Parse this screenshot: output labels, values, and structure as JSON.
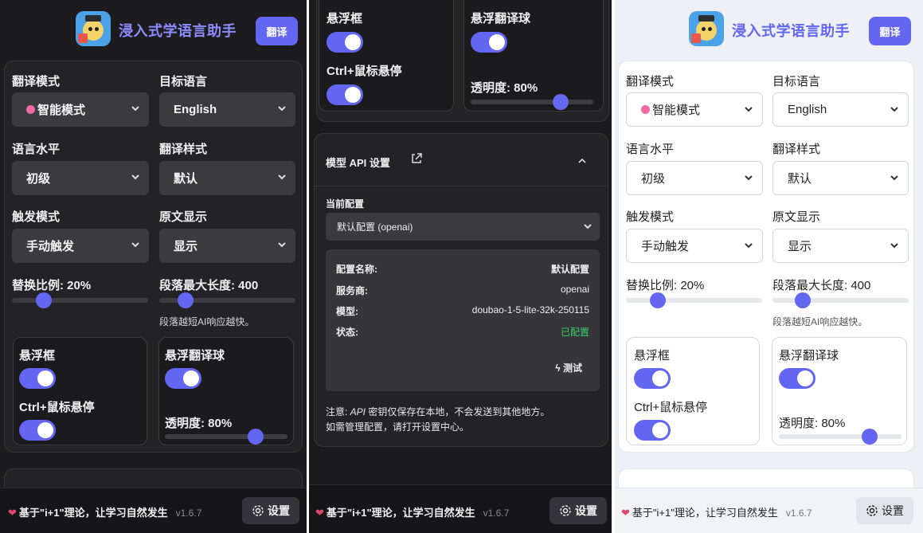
{
  "header": {
    "title": "浸入式学语言助手",
    "translate_button": "翻译"
  },
  "settings": {
    "translation_mode": {
      "label": "翻译模式",
      "value": "智能模式"
    },
    "target_language": {
      "label": "目标语言",
      "value": "English"
    },
    "language_level": {
      "label": "语言水平",
      "value": "初级"
    },
    "translation_style": {
      "label": "翻译样式",
      "value": "默认"
    },
    "trigger_mode": {
      "label": "触发模式",
      "value": "手动触发"
    },
    "original_display": {
      "label": "原文显示",
      "value": "显示"
    },
    "replace_ratio": {
      "label": "替换比例: 20%",
      "value": 0.2
    },
    "max_paragraph": {
      "label": "段落最大长度: 400",
      "value": 0.2,
      "hint": "段落越短AI响应越快。"
    }
  },
  "toggles": {
    "float_box": {
      "label": "悬浮框",
      "on": true
    },
    "ctrl_hover": {
      "label": "Ctrl+鼠标悬停",
      "on": true
    },
    "float_ball": {
      "label": "悬浮翻译球",
      "on": true
    },
    "opacity": {
      "label": "透明度: 80%",
      "value": 0.8
    }
  },
  "api": {
    "title": "模型 API 设置",
    "current_label": "当前配置",
    "current_value": "默认配置 (openai)",
    "rows": [
      {
        "k": "配置名称:",
        "v": "默认配置"
      },
      {
        "k": "服务商:",
        "v": "openai"
      },
      {
        "k": "模型:",
        "v": "doubao-1-5-lite-32k-250115"
      },
      {
        "k": "状态:",
        "v": "已配置"
      }
    ],
    "test_button": "测试",
    "note_line1_prefix": "注意: ",
    "note_line1_em": "API",
    "note_line1_rest": " 密钥仅保存在本地，不会发送到其他地方。",
    "note_line2": "如需管理配置，请打开设置中心。"
  },
  "footer": {
    "text": "基于\"i+1\"理论，让学习自然发生",
    "version": "v1.6.7",
    "settings_button": "设置"
  },
  "colors": {
    "accent": "#6366f1",
    "heart": "#e0456a",
    "status_ok": "#3ccf6a"
  }
}
